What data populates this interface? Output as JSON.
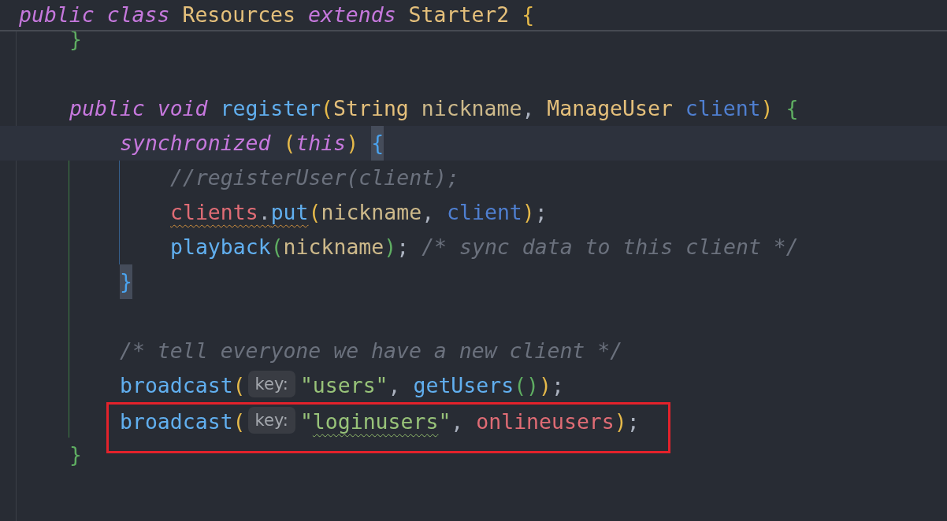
{
  "sticky_header": {
    "tokens": [
      {
        "text": "public ",
        "kind": "keyword"
      },
      {
        "text": "class ",
        "kind": "keyword"
      },
      {
        "text": "Resources ",
        "kind": "type"
      },
      {
        "text": "extends ",
        "kind": "keyword"
      },
      {
        "text": "Starter2 ",
        "kind": "type"
      },
      {
        "text": "{",
        "kind": "bracket1"
      }
    ]
  },
  "lines": [
    {
      "kind": "code",
      "segments": [
        {
          "kind": "code",
          "tokens": [
            {
              "text": "}",
              "kind": "bracket2"
            }
          ]
        }
      ]
    },
    {
      "kind": "blank"
    },
    {
      "kind": "code",
      "segments": [
        {
          "kind": "code",
          "tokens": [
            {
              "text": "public ",
              "kind": "keyword"
            },
            {
              "text": "void ",
              "kind": "keyword"
            },
            {
              "text": "register",
              "kind": "method"
            },
            {
              "text": "(",
              "kind": "bracket1"
            },
            {
              "text": "String ",
              "kind": "type"
            },
            {
              "text": "nickname",
              "kind": "param"
            },
            {
              "text": ", ",
              "kind": "punct"
            },
            {
              "text": "ManageUser ",
              "kind": "type"
            },
            {
              "text": "client",
              "kind": "param2"
            },
            {
              "text": ") ",
              "kind": "bracket1"
            },
            {
              "text": "{",
              "kind": "bracket2"
            }
          ]
        }
      ],
      "children": [
        {
          "kind": "code",
          "current": true,
          "segments": [
            {
              "kind": "code",
              "tokens": [
                {
                  "text": "synchronized ",
                  "kind": "keyword"
                },
                {
                  "text": "(",
                  "kind": "bracket1"
                },
                {
                  "text": "this",
                  "kind": "keyword"
                },
                {
                  "text": ") ",
                  "kind": "bracket1"
                },
                {
                  "text": "{",
                  "kind": "bracket3",
                  "matched": true
                }
              ]
            }
          ],
          "children": [
            {
              "kind": "code",
              "segments": [
                {
                  "kind": "code",
                  "tokens": [
                    {
                      "text": "//registerUser(client);",
                      "kind": "comment"
                    }
                  ]
                }
              ]
            },
            {
              "kind": "code",
              "segments": [
                {
                  "kind": "code",
                  "tokens": [
                    {
                      "text": "clients",
                      "kind": "field",
                      "warning": true
                    },
                    {
                      "text": ".",
                      "kind": "punct",
                      "warning": true
                    },
                    {
                      "text": "put",
                      "kind": "method",
                      "warning": true
                    },
                    {
                      "text": "(",
                      "kind": "bracket1"
                    },
                    {
                      "text": "nickname",
                      "kind": "param"
                    },
                    {
                      "text": ", ",
                      "kind": "punct"
                    },
                    {
                      "text": "client",
                      "kind": "param2"
                    },
                    {
                      "text": ")",
                      "kind": "bracket1"
                    },
                    {
                      "text": ";",
                      "kind": "punct"
                    }
                  ]
                }
              ]
            },
            {
              "kind": "code",
              "segments": [
                {
                  "kind": "code",
                  "tokens": [
                    {
                      "text": "playback",
                      "kind": "method"
                    },
                    {
                      "text": "(",
                      "kind": "bracket2"
                    },
                    {
                      "text": "nickname",
                      "kind": "param"
                    },
                    {
                      "text": ")",
                      "kind": "bracket2"
                    },
                    {
                      "text": "; ",
                      "kind": "punct"
                    },
                    {
                      "text": "/* sync data to this client */",
                      "kind": "comment"
                    }
                  ]
                }
              ]
            }
          ]
        },
        {
          "kind": "code",
          "segments": [
            {
              "kind": "code",
              "tokens": [
                {
                  "text": "}",
                  "kind": "bracket3",
                  "matched": true
                }
              ]
            }
          ]
        },
        {
          "kind": "blank"
        },
        {
          "kind": "code",
          "segments": [
            {
              "kind": "code",
              "tokens": [
                {
                  "text": "/* tell everyone we have a new client */",
                  "kind": "comment"
                }
              ]
            }
          ]
        },
        {
          "kind": "code",
          "segments": [
            {
              "kind": "code",
              "tokens": [
                {
                  "text": "broadcast",
                  "kind": "method"
                },
                {
                  "text": "(",
                  "kind": "bracket1"
                }
              ]
            },
            {
              "kind": "hint",
              "text": "key:"
            },
            {
              "kind": "code",
              "tokens": [
                {
                  "text": "\"users\"",
                  "kind": "string"
                },
                {
                  "text": ", ",
                  "kind": "punct"
                },
                {
                  "text": "getUsers",
                  "kind": "method"
                },
                {
                  "text": "(",
                  "kind": "bracket2"
                },
                {
                  "text": ")",
                  "kind": "bracket2"
                },
                {
                  "text": ")",
                  "kind": "bracket1"
                },
                {
                  "text": ";",
                  "kind": "punct"
                }
              ]
            }
          ]
        },
        {
          "kind": "code",
          "framed": true,
          "segments": [
            {
              "kind": "code",
              "tokens": [
                {
                  "text": "broadcast",
                  "kind": "method"
                },
                {
                  "text": "(",
                  "kind": "bracket1"
                }
              ]
            },
            {
              "kind": "hint",
              "text": "key:"
            },
            {
              "kind": "code",
              "tokens": [
                {
                  "text": "\"",
                  "kind": "string"
                },
                {
                  "text": "loginusers",
                  "kind": "string",
                  "typo": true
                },
                {
                  "text": "\"",
                  "kind": "string"
                },
                {
                  "text": ", ",
                  "kind": "punct"
                },
                {
                  "text": "onlineusers",
                  "kind": "field"
                },
                {
                  "text": ")",
                  "kind": "bracket1"
                },
                {
                  "text": ";",
                  "kind": "punct"
                }
              ]
            }
          ]
        }
      ]
    },
    {
      "kind": "code",
      "segments": [
        {
          "kind": "code",
          "tokens": [
            {
              "text": "}",
              "kind": "bracket2"
            }
          ]
        }
      ]
    }
  ]
}
